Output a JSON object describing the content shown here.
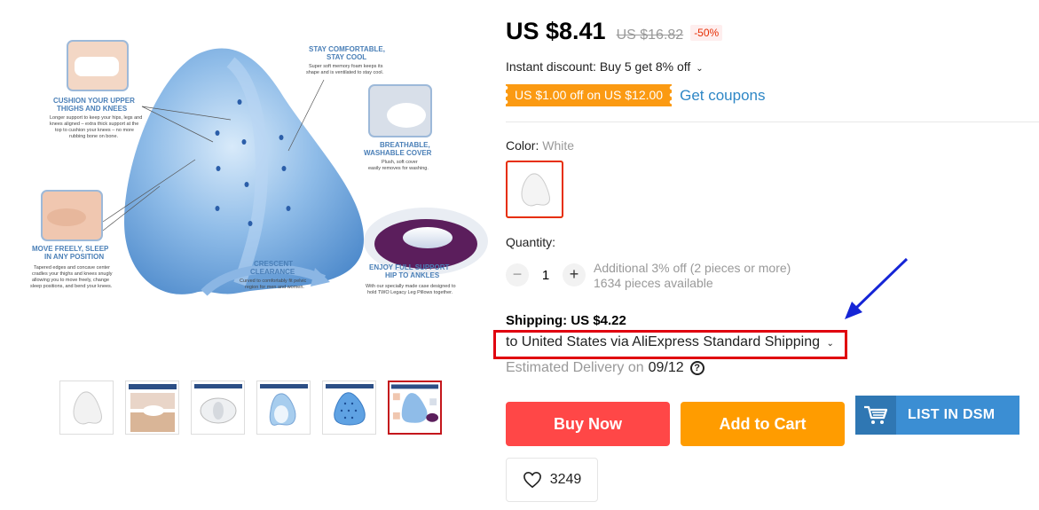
{
  "gallery": {
    "annotations": {
      "cushion_title_1": "CUSHION YOUR UPPER",
      "cushion_title_2": "THIGHS AND KNEES",
      "cushion_body_1": "Longer support to keep your hips, legs and",
      "cushion_body_2": "knees aligned – extra thick support at the",
      "cushion_body_3": "top to cushion your knees – no more",
      "cushion_body_4": "rubbing bone on bone.",
      "stay_title_1": "STAY COMFORTABLE,",
      "stay_title_2": "STAY COOL",
      "stay_body_1": "Super soft memory foam keeps its",
      "stay_body_2": "shape and is ventilated to stay cool.",
      "breath_title_1": "BREATHABLE,",
      "breath_title_2": "WASHABLE COVER",
      "breath_body_1": "Plush, soft cover",
      "breath_body_2": "easily removes for washing.",
      "move_title_1": "MOVE FREELY, SLEEP",
      "move_title_2": "IN ANY POSITION",
      "move_body_1": "Tapered edges and concave center",
      "move_body_2": "cradles your thighs and knees snugly",
      "move_body_3": "allowing you to move freely, change",
      "move_body_4": "sleep positions, and bend your knees.",
      "crescent_title_1": "CRESCENT",
      "crescent_title_2": "CLEARANCE",
      "crescent_body_1": "Curved to comfortably fit pelvic",
      "crescent_body_2": "region for men and women.",
      "hip_title_1": "ENJOY FULL SUPPORT",
      "hip_title_2": "HIP TO ANKLES",
      "hip_body_1": "With our specially made case designed to",
      "hip_body_2": "hold TWO Legacy Leg Pillows together."
    },
    "thumbnail_count": 6,
    "active_thumbnail": 6
  },
  "price": {
    "current": "US $8.41",
    "original": "US $16.82",
    "discount": "-50%"
  },
  "instant_discount": "Instant discount: Buy 5 get 8% off",
  "coupon": {
    "tag": "US $1.00 off on US $12.00",
    "link": "Get coupons"
  },
  "color": {
    "label": "Color:",
    "value": "White"
  },
  "quantity": {
    "label": "Quantity:",
    "minus": "−",
    "value": "1",
    "plus": "+",
    "extra_discount": "Additional 3% off (2 pieces or more)",
    "available": "1634 pieces available"
  },
  "shipping": {
    "title": "Shipping: US $4.22",
    "destination": "to United States via AliExpress Standard Shipping",
    "estimated_label": "Estimated Delivery on",
    "estimated_date": "09/12",
    "help": "?"
  },
  "actions": {
    "buy_now": "Buy Now",
    "add_to_cart": "Add to Cart",
    "list_dsm": "LIST IN DSM",
    "wishlist_count": "3249"
  },
  "colors": {
    "price_red": "#e62e04",
    "coupon_orange": "#fb9a12",
    "link_blue": "#2e87c6",
    "buy_now": "#ff4747",
    "add_to_cart": "#ff9c00",
    "dsm_blue": "#3b8ed3",
    "highlight_box": "#e0000f",
    "arrow": "#1525d6"
  }
}
